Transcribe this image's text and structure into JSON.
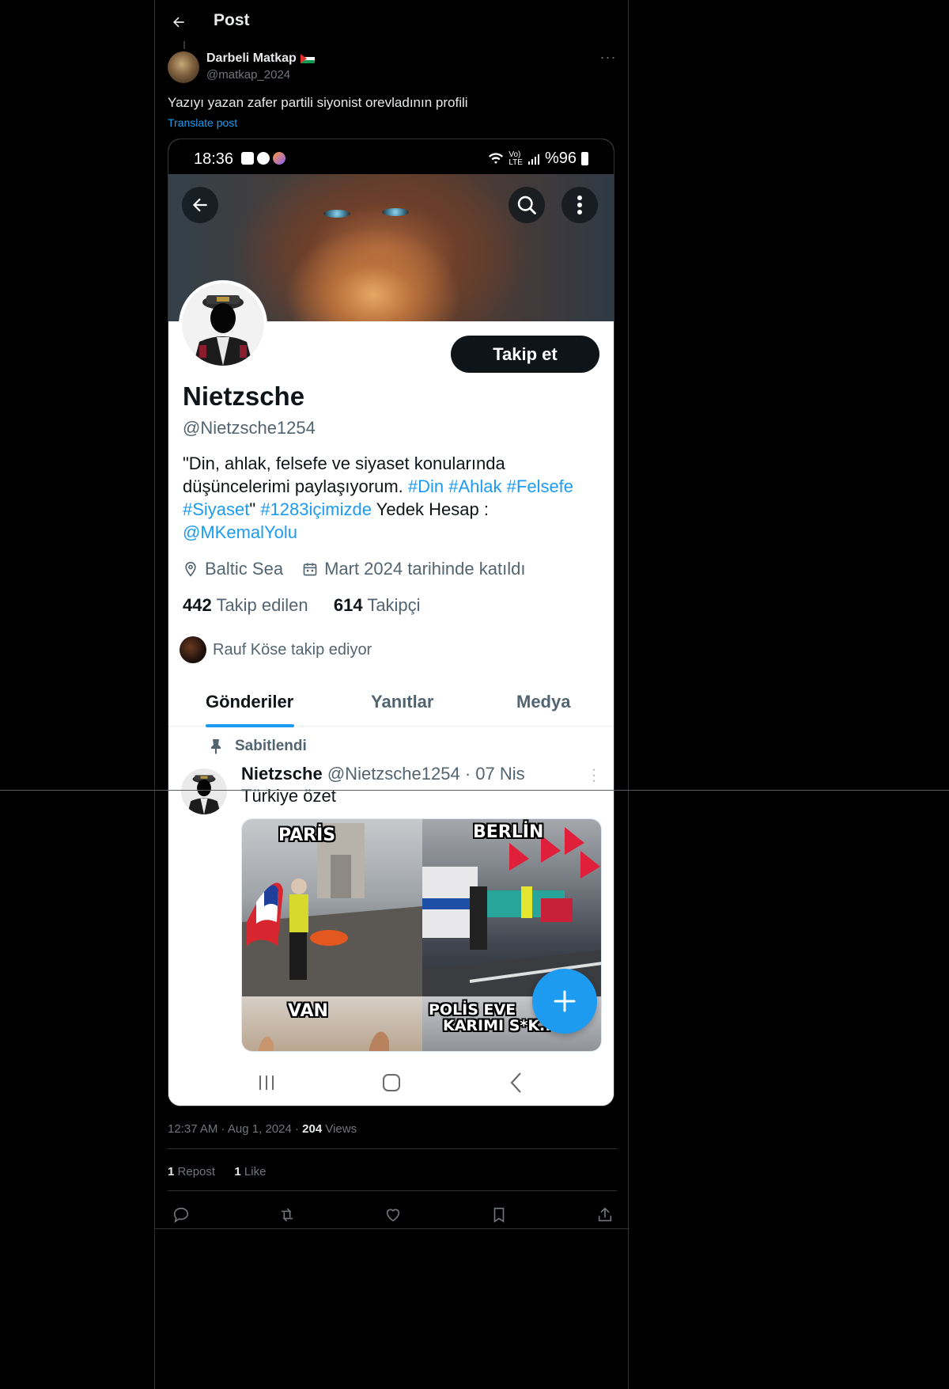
{
  "header": {
    "title": "Post"
  },
  "author": {
    "name": "Darbeli Matkap",
    "handle": "@matkap_2024"
  },
  "post": {
    "text": "Yazıyı yazan zafer partili siyonist orevladının profili",
    "translate_label": "Translate post"
  },
  "screenshot": {
    "status_time": "18:36",
    "battery_text": "%96",
    "lte_top": "Vo)",
    "lte_bottom": "LTE",
    "follow_button": "Takip et",
    "profile_name": "Nietzsche",
    "profile_handle": "@Nietzsche1254",
    "bio_part1": "\"Din, ahlak, felsefe ve siyaset konularında düşüncelerimi paylaşıyorum. ",
    "bio_tags1": "#Din #Ahlak #Felsefe #Siyaset",
    "bio_part2": "\" ",
    "bio_tag2": "#1283içimizde",
    "bio_part3": " Yedek Hesap : ",
    "bio_mention": "@MKemalYolu",
    "location": "Baltic Sea",
    "joined": "Mart 2024 tarihinde katıldı",
    "following_count": "442",
    "following_label": "Takip edilen",
    "followers_count": "614",
    "followers_label": "Takipçi",
    "followed_by": "Rauf Köse takip ediyor",
    "tabs": [
      "Gönderiler",
      "Yanıtlar",
      "Medya"
    ],
    "pinned_label": "Sabitlendi",
    "tweet_name": "Nietzsche",
    "tweet_meta": "@Nietzsche1254 · 07 Nis",
    "tweet_text": "Türkiye özet",
    "captions": {
      "paris": "PARİS",
      "berlin": "BERLİN",
      "van": "VAN",
      "polis1": "POLİS EVE",
      "polis2": "KARIMI S*K.."
    }
  },
  "footer": {
    "time": "12:37 AM",
    "date": "Aug 1, 2024",
    "views_count": "204",
    "views_label": "Views",
    "reposts_count": "1",
    "reposts_label": "Repost",
    "likes_count": "1",
    "likes_label": "Like"
  },
  "colors": {
    "accent": "#1d9bf0",
    "background": "#000000",
    "text": "#e7e9ea",
    "muted": "#71767b"
  }
}
